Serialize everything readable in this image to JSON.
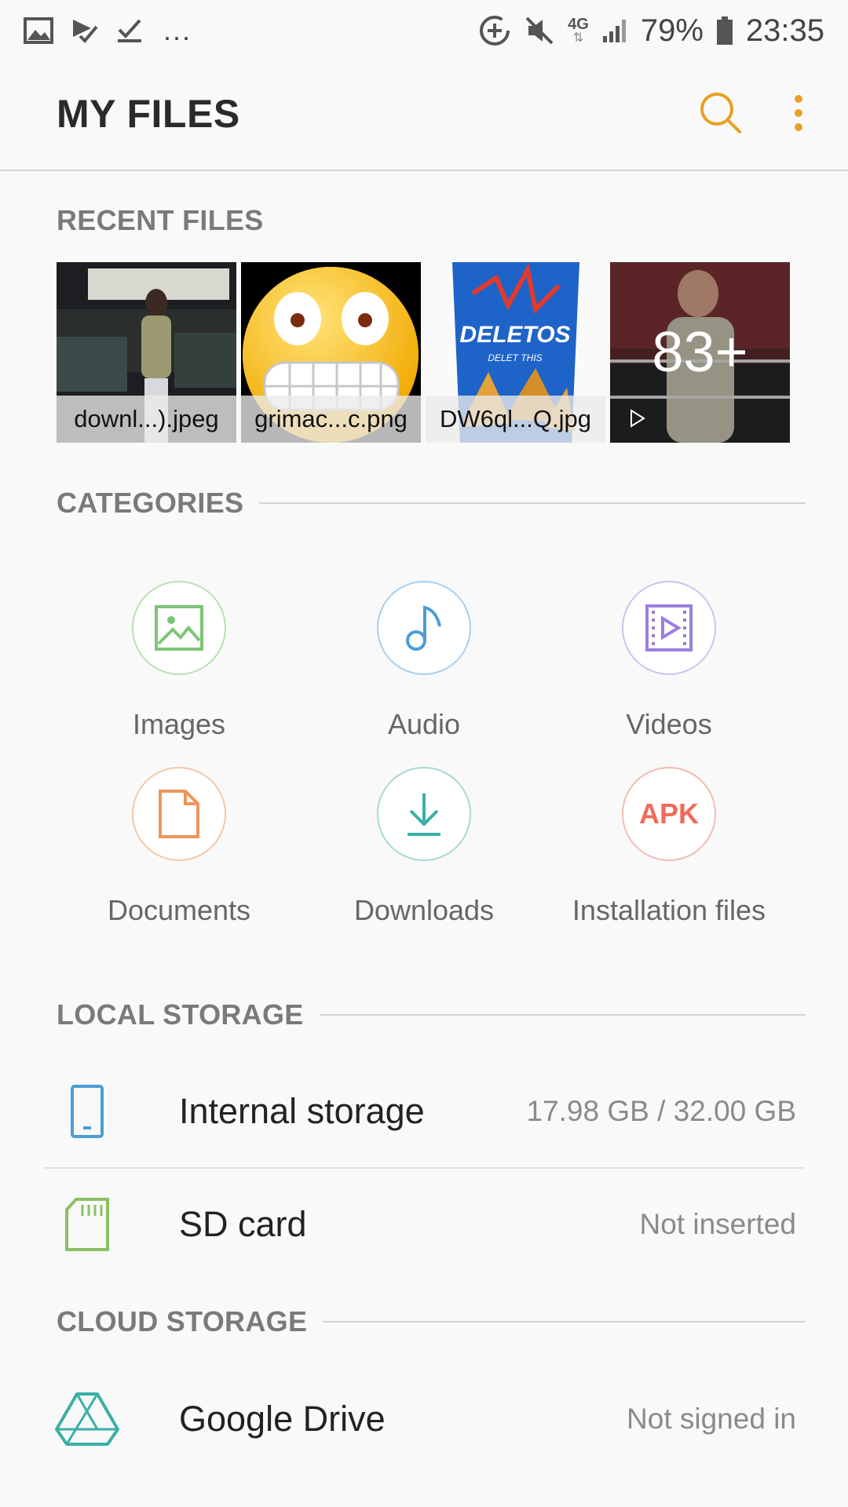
{
  "status_bar": {
    "left_icons": [
      "gallery-icon",
      "checklist-icon",
      "checkmark-icon"
    ],
    "overflow": "...",
    "right_icons": [
      "data-saver-icon",
      "mute-icon",
      "network-4g-icon",
      "signal-icon"
    ],
    "network": "4G",
    "battery": "79%",
    "time": "23:35"
  },
  "app_bar": {
    "title": "MY FILES",
    "icons": [
      "search-icon",
      "more-options-icon"
    ],
    "accent_color": "#e8a024"
  },
  "recent": {
    "header": "RECENT FILES",
    "files": [
      {
        "name": "downl...).jpeg"
      },
      {
        "name": "grimac...c.png"
      },
      {
        "name": "DW6ql...Q.jpg"
      }
    ],
    "more_count": "83+"
  },
  "categories": {
    "header": "CATEGORIES",
    "items": [
      {
        "label": "Images",
        "icon": "image-icon",
        "color": "#7cc576"
      },
      {
        "label": "Audio",
        "icon": "music-note-icon",
        "color": "#4a9ed6"
      },
      {
        "label": "Videos",
        "icon": "video-icon",
        "color": "#9b7fe0"
      },
      {
        "label": "Documents",
        "icon": "document-icon",
        "color": "#f0955a"
      },
      {
        "label": "Downloads",
        "icon": "download-icon",
        "color": "#3aafa6"
      },
      {
        "label": "Installation files",
        "icon": "apk-icon",
        "color": "#ef6b5b",
        "icon_text": "APK"
      }
    ]
  },
  "local_storage": {
    "header": "LOCAL STORAGE",
    "items": [
      {
        "name": "Internal storage",
        "value": "17.98 GB / 32.00 GB",
        "icon": "phone-icon",
        "color": "#4a9ed6"
      },
      {
        "name": "SD card",
        "value": "Not inserted",
        "icon": "sd-card-icon",
        "color": "#8cc063"
      }
    ]
  },
  "cloud_storage": {
    "header": "CLOUD STORAGE",
    "items": [
      {
        "name": "Google Drive",
        "value": "Not signed in",
        "icon": "google-drive-icon",
        "color": "#3aafa6"
      }
    ]
  }
}
